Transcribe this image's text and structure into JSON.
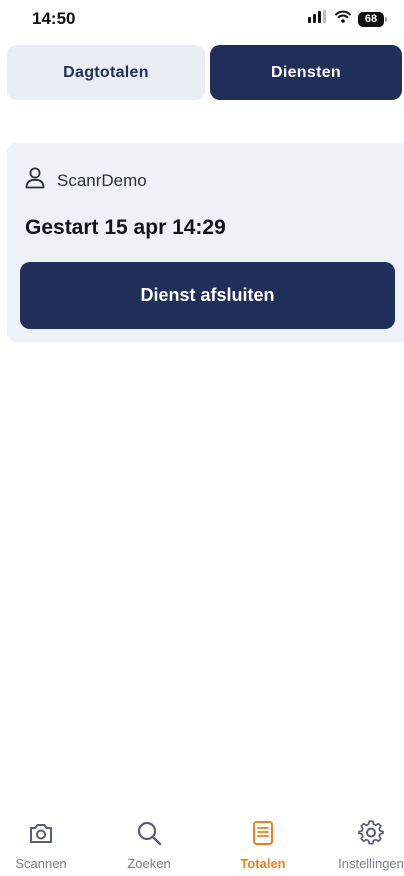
{
  "status_bar": {
    "time": "14:50",
    "battery": "68",
    "icons": [
      "signal-icon",
      "wifi-icon",
      "battery-icon"
    ]
  },
  "tabs": [
    {
      "label": "Dagtotalen",
      "active": false
    },
    {
      "label": "Diensten",
      "active": true
    }
  ],
  "shift_card": {
    "user_icon": "user-icon",
    "user_name": "ScanrDemo",
    "started": "Gestart 15 apr 14:29",
    "end_button_label": "Dienst afsluiten"
  },
  "bottom_nav": {
    "items": [
      {
        "label": "Scannen",
        "icon": "camera-icon",
        "active": false
      },
      {
        "label": "Zoeken",
        "icon": "search-icon",
        "active": false
      },
      {
        "label": "Totalen",
        "icon": "list-icon",
        "active": true
      },
      {
        "label": "Instellingen",
        "icon": "gear-icon",
        "active": false
      }
    ]
  },
  "colors": {
    "primary": "#202e5a",
    "accent": "#f0801d",
    "tab_inactive_bg": "#e9eef5",
    "card_bg": "#eef1f6",
    "nav_inactive": "#7b8090"
  }
}
